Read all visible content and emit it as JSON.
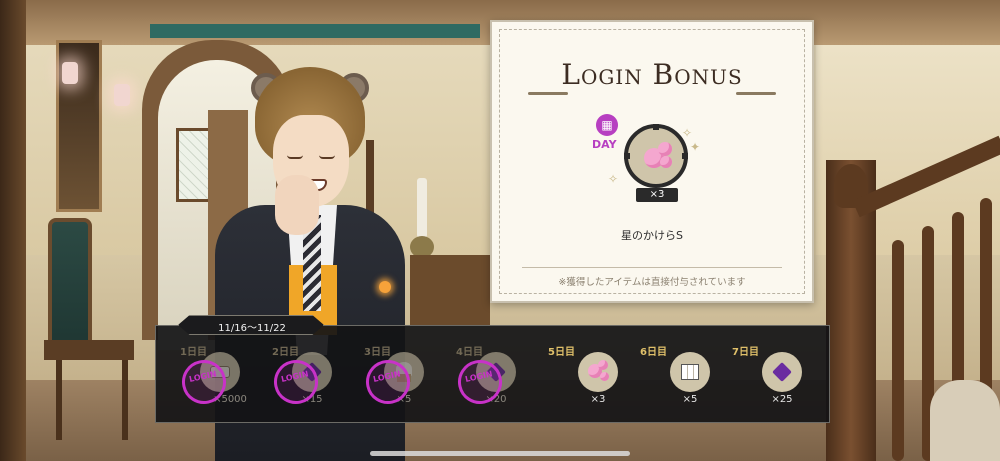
{
  "login_bonus": {
    "title": "Login Bonus",
    "day_badge_label": "DAY",
    "day_icon": "calendar-icon",
    "featured_item": {
      "icon": "star-fragment-icon",
      "quantity": "×3",
      "name": "星のかけらS"
    },
    "note": "※獲得したアイテムは直接付与されています"
  },
  "week": {
    "date_range": "11/16〜11/22",
    "days": [
      {
        "label": "1日目",
        "quantity": "×5000",
        "icon": "coin-icon",
        "claimed": true
      },
      {
        "label": "2日目",
        "quantity": "×15",
        "icon": "gem-icon",
        "claimed": true
      },
      {
        "label": "3日目",
        "quantity": "×5",
        "icon": "cupcake-icon",
        "claimed": true
      },
      {
        "label": "4日目",
        "quantity": "×20",
        "icon": "gem-icon",
        "claimed": true
      },
      {
        "label": "5日目",
        "quantity": "×3",
        "icon": "star-fragment-icon",
        "claimed": false
      },
      {
        "label": "6日目",
        "quantity": "×5",
        "icon": "sugar-cubes-icon",
        "claimed": false
      },
      {
        "label": "7日目",
        "quantity": "×25",
        "icon": "gem-icon",
        "claimed": false
      }
    ],
    "stamp_text": "LOGIN"
  },
  "colors": {
    "accent_magenta": "#b73fc1",
    "day_label_gold": "#e0c06a",
    "strip_bg": "#141416",
    "panel_bg": "#fbf8ef"
  }
}
